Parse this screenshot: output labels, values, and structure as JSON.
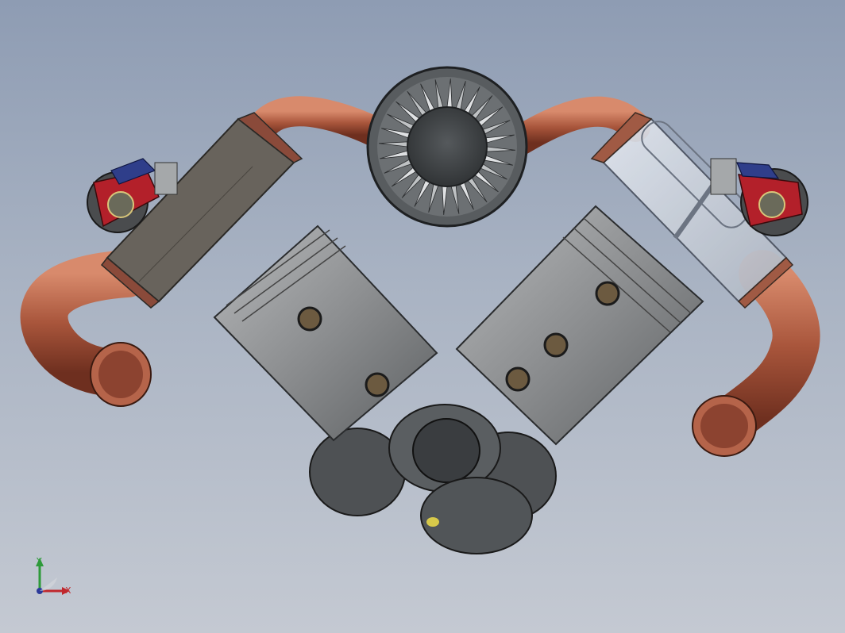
{
  "viewport": {
    "background_top": "#8e9cb3",
    "background_bottom": "#c4c9d2"
  },
  "triad": {
    "x_label": "X",
    "y_label": "Y",
    "x_color": "#c0282d",
    "y_color": "#2e9a3a",
    "z_color": "#2c3a9a"
  },
  "model": {
    "parts": [
      "intake-manifold",
      "impeller-wheel",
      "cylinder-block-left",
      "cylinder-block-right",
      "rocker-arm-left",
      "rocker-arm-right",
      "piston-left",
      "piston-right",
      "crankshaft-housing",
      "exhaust-pipe-left",
      "exhaust-pipe-right"
    ],
    "copper_color": "#a8553b",
    "steel_color": "#8c8e90",
    "dark_color": "#3c3f42",
    "rocker_color": "#b3202a",
    "bracket_color": "#2f3e8a"
  }
}
